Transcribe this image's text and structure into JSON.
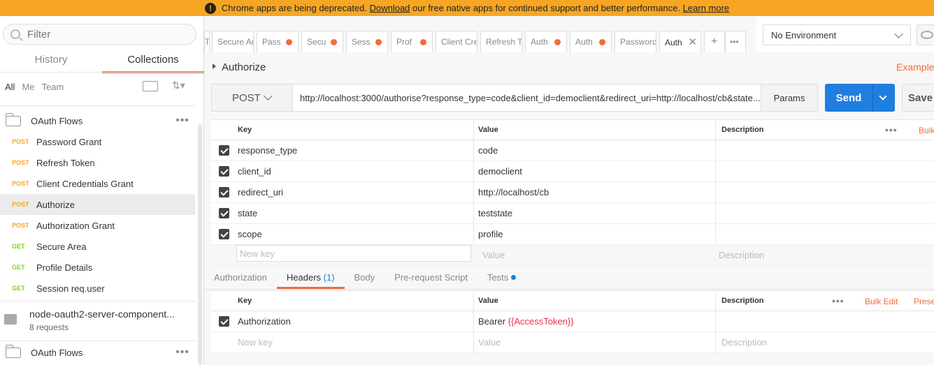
{
  "banner": {
    "text1": "Chrome apps are being deprecated. ",
    "link1": "Download",
    "text2": " our free native apps for continued support and better performance. ",
    "link2": "Learn more"
  },
  "sidebar": {
    "filter_placeholder": "Filter",
    "tabs": [
      "History",
      "Collections"
    ],
    "filters": [
      "All",
      "Me",
      "Team"
    ],
    "folder1": "OAuth Flows",
    "items": [
      {
        "method": "POST",
        "name": "Password Grant"
      },
      {
        "method": "POST",
        "name": "Refresh Token"
      },
      {
        "method": "POST",
        "name": "Client Credentials Grant"
      },
      {
        "method": "POST",
        "name": "Authorize"
      },
      {
        "method": "POST",
        "name": "Authorization Grant"
      },
      {
        "method": "GET",
        "name": "Secure Area"
      },
      {
        "method": "GET",
        "name": "Profile Details"
      },
      {
        "method": "GET",
        "name": "Session req.user"
      }
    ],
    "collection": {
      "title": "node-oauth2-server-component...",
      "subtitle": "8 requests"
    },
    "folder2": "OAuth Flows"
  },
  "tabs": [
    "Tc",
    "Secure Arc",
    "Pass",
    "Secu",
    "Sess",
    "Prof",
    "Client Cre",
    "Refresh Tc",
    "Auth",
    "Auth",
    "Password",
    "Auth"
  ],
  "environment": {
    "selected": "No Environment"
  },
  "request": {
    "name": "Authorize",
    "examples": "Examples",
    "method": "POST",
    "url": "http://localhost:3000/authorise?response_type=code&client_id=democlient&redirect_uri=http://localhost/cb&state...",
    "params_label": "Params",
    "send_label": "Send",
    "save_label": "Save"
  },
  "params_table": {
    "headers": [
      "Key",
      "Value",
      "Description"
    ],
    "bulk": "Bulk",
    "rows": [
      {
        "key": "response_type",
        "value": "code"
      },
      {
        "key": "client_id",
        "value": "democlient"
      },
      {
        "key": "redirect_uri",
        "value": "http://localhost/cb"
      },
      {
        "key": "state",
        "value": "teststate"
      },
      {
        "key": "scope",
        "value": "profile"
      }
    ],
    "new_key": "New key",
    "new_value": "Value",
    "new_desc": "Description"
  },
  "subtabs": {
    "authorization": "Authorization",
    "headers": "Headers",
    "headers_count": "(1)",
    "body": "Body",
    "prerequest": "Pre-request Script",
    "tests": "Tests"
  },
  "headers_table": {
    "headers": [
      "Key",
      "Value",
      "Description"
    ],
    "bulk_edit": "Bulk Edit",
    "presets": "Prese",
    "row": {
      "key": "Authorization",
      "value_prefix": "Bearer ",
      "value_var": "{{AccessToken}}"
    },
    "new_key": "New key",
    "new_value": "Value",
    "new_desc": "Description"
  },
  "colors": {
    "accent": "#f26b3a",
    "send": "#1f7ee0",
    "banner": "#f6a623",
    "post": "#f5a623",
    "get": "#7ed321"
  }
}
